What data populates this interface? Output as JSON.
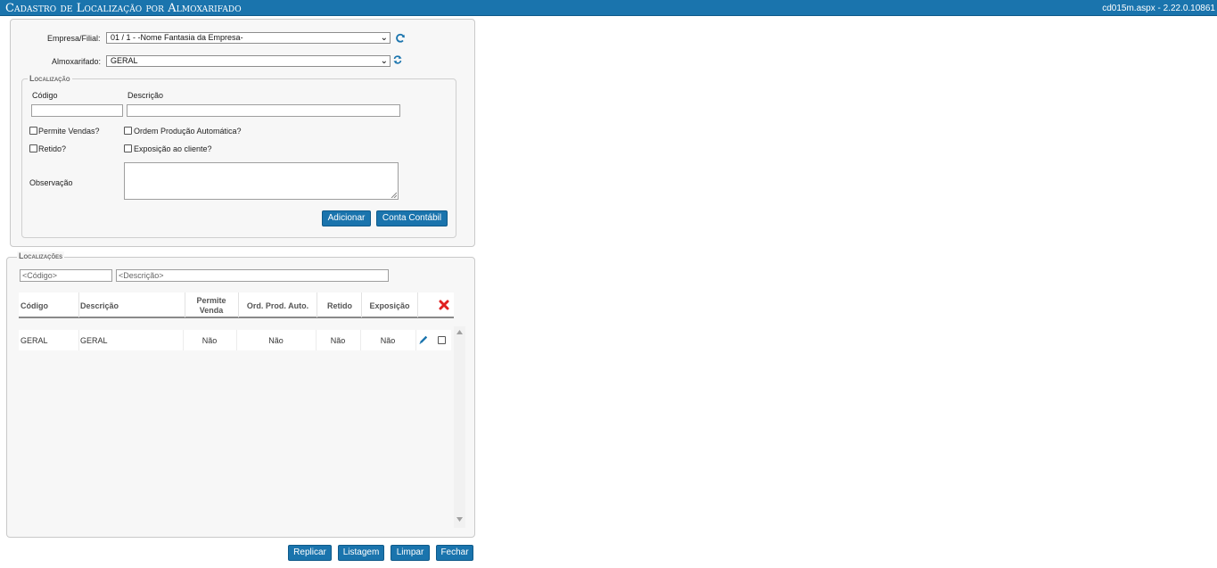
{
  "window": {
    "title": "Cadastro de Localização por Almoxarifado",
    "version": "cd015m.aspx - 2.22.0.10861"
  },
  "form": {
    "empresa_label": "Empresa/Filial:",
    "empresa_value": "01 / 1 - -Nome Fantasia da Empresa-",
    "almox_label": "Almoxarifado:",
    "almox_value": "GERAL"
  },
  "localizacao": {
    "legend": "Localização",
    "codigo_label": "Código",
    "descricao_label": "Descrição",
    "permite_vendas": "Permite Vendas?",
    "ordem_producao": "Ordem Produção Automática?",
    "retido": "Retido?",
    "exposicao": "Exposição ao cliente?",
    "observacao_label": "Observação",
    "adicionar": "Adicionar",
    "conta_contabil": "Conta Contábil"
  },
  "localizacoes": {
    "legend": "Localizações",
    "filter_codigo_placeholder": "<Código>",
    "filter_descricao_placeholder": "<Descrição>",
    "columns": {
      "codigo": "Código",
      "descricao": "Descrição",
      "permite_venda_1": "Permite",
      "permite_venda_2": "Venda",
      "ord_prod": "Ord. Prod. Auto.",
      "retido": "Retido",
      "exposicao": "Exposição"
    },
    "rows": [
      {
        "codigo": "GERAL",
        "descricao": "GERAL",
        "permite_venda": "Não",
        "ord_prod": "Não",
        "retido": "Não",
        "exposicao": "Não"
      }
    ]
  },
  "footer": {
    "replicar": "Replicar",
    "listagem": "Listagem",
    "limpar": "Limpar",
    "fechar": "Fechar"
  },
  "colors": {
    "accent": "#1a74ad",
    "delete": "#e02020"
  }
}
